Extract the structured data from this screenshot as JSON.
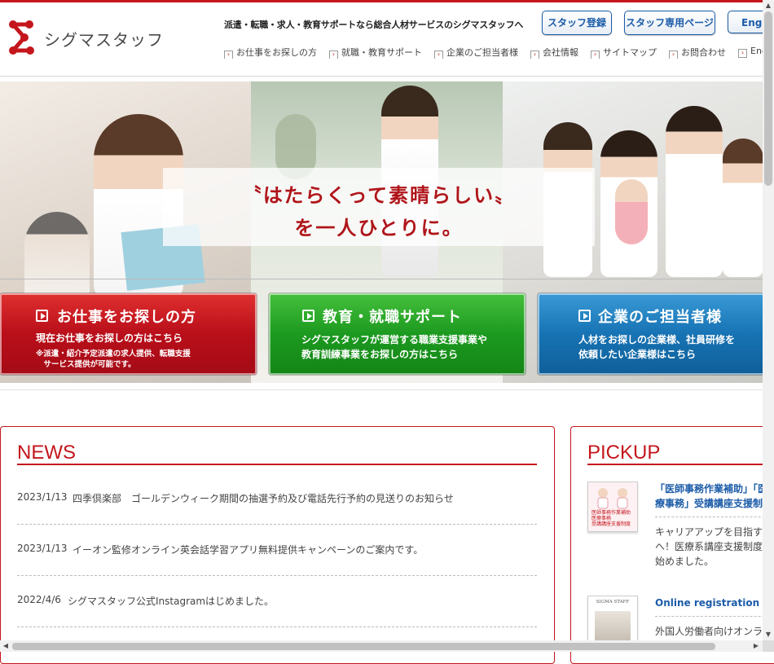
{
  "brand": {
    "name": "シグマスタッフ",
    "accent": "#c4161c",
    "link_blue": "#1c5ca8"
  },
  "header": {
    "tagline": "派遣・転職・求人・教育サポートなら総合人材サービスのシグマスタッフへ",
    "buttons": [
      "スタッフ登録",
      "スタッフ専用ページ",
      "English"
    ],
    "nav": [
      "お仕事をお探しの方",
      "就職・教育サポート",
      "企業のご担当者様",
      "会社情報",
      "サイトマップ",
      "お問合わせ",
      "English"
    ]
  },
  "hero": {
    "line1": "〝はたらくって素晴らしい〟",
    "line2": "を一人ひとりに。",
    "ctas": [
      {
        "title": "お仕事をお探しの方",
        "sub": "現在お仕事をお探しの方はこちら",
        "note": [
          "※派遣・紹介予定派遣の求人提供、転職支援",
          "　サービス提供が可能です。"
        ],
        "color": "#c4161c"
      },
      {
        "title": "教育・就職サポート",
        "sub": [
          "シグマスタッフが運営する職業支援事業や",
          "教育訓練事業をお探しの方はこちら"
        ],
        "color": "#1f9a22"
      },
      {
        "title": "企業のご担当者様",
        "sub": [
          "人材をお探しの企業様、社員研修を",
          "依頼したい企業様はこちら"
        ],
        "color": "#1773b4"
      }
    ]
  },
  "news": {
    "title": "NEWS",
    "items": [
      {
        "date": "2023/1/13",
        "text": "四季倶楽部　ゴールデンウィーク期間の抽選予約及び電話先行予約の見送りのお知らせ"
      },
      {
        "date": "2023/1/13",
        "text": "イーオン監修オンライン英会話学習アプリ無料提供キャンペーンのご案内です。"
      },
      {
        "date": "2022/4/6",
        "text": "シグマスタッフ公式Instagramはじめました。"
      }
    ]
  },
  "pickup": {
    "title": "PICKUP",
    "items": [
      {
        "title": [
          "「医師事務作業補助」「医",
          "療事務」受講講座支援制度"
        ],
        "text": [
          "キャリアアップを目指す方",
          "へ！医療系講座支援制度を",
          "始めました。"
        ],
        "thumb_text": [
          "医師事務作業補助",
          "医療事務",
          "受講講座支援制度"
        ]
      },
      {
        "title": [
          "Online registration"
        ],
        "text": [
          "外国人労働者向けオンライン"
        ],
        "thumb_text": [
          "SIGMA STAFF"
        ]
      }
    ]
  }
}
